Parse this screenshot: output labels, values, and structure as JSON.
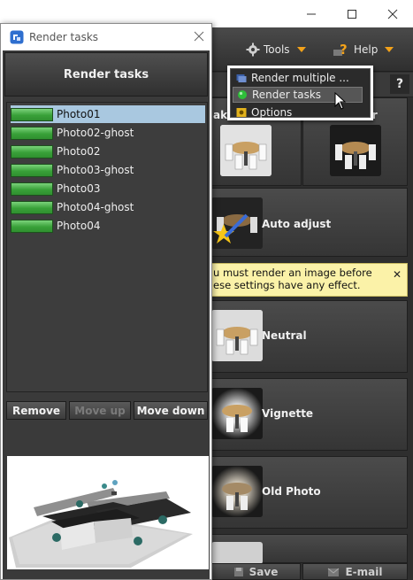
{
  "main": {
    "menu": {
      "tools_label": "Tools",
      "help_label": "Help"
    },
    "help_question": "?",
    "tiles": [
      {
        "label": "Auto adjust"
      },
      {
        "label": "Neutral"
      },
      {
        "label": "Vignette"
      },
      {
        "label": "Old Photo"
      }
    ],
    "top_tiles": {
      "left_partial": "ake",
      "right_partial": "ker"
    },
    "notice": {
      "text": "u must render an image before ese settings have any effect.",
      "close": "✕"
    },
    "bottom_buttons": {
      "save": "Save",
      "email": "E-mail"
    }
  },
  "dropdown": {
    "items": [
      {
        "label": "Render multiple ...",
        "icon": "render-multiple-icon"
      },
      {
        "label": "Render tasks",
        "icon": "green-dot-icon",
        "selected": true
      },
      {
        "label": "Options",
        "icon": "options-icon"
      }
    ]
  },
  "render_tasks": {
    "window_title": "Render tasks",
    "header": "Render tasks",
    "tasks": [
      {
        "name": "Photo01",
        "selected": true,
        "progress": 1.0
      },
      {
        "name": "Photo02-ghost",
        "selected": false,
        "progress": 1.0
      },
      {
        "name": "Photo02",
        "selected": false,
        "progress": 1.0
      },
      {
        "name": "Photo03-ghost",
        "selected": false,
        "progress": 1.0
      },
      {
        "name": "Photo03",
        "selected": false,
        "progress": 1.0
      },
      {
        "name": "Photo04-ghost",
        "selected": false,
        "progress": 1.0
      },
      {
        "name": "Photo04",
        "selected": false,
        "progress": 1.0
      }
    ],
    "buttons": {
      "remove": "Remove",
      "move_up": "Move up",
      "move_down": "Move down"
    },
    "colors": {
      "progress": "#39a139",
      "selection": "#a9c8e0",
      "accent": "#f3a21a"
    }
  }
}
